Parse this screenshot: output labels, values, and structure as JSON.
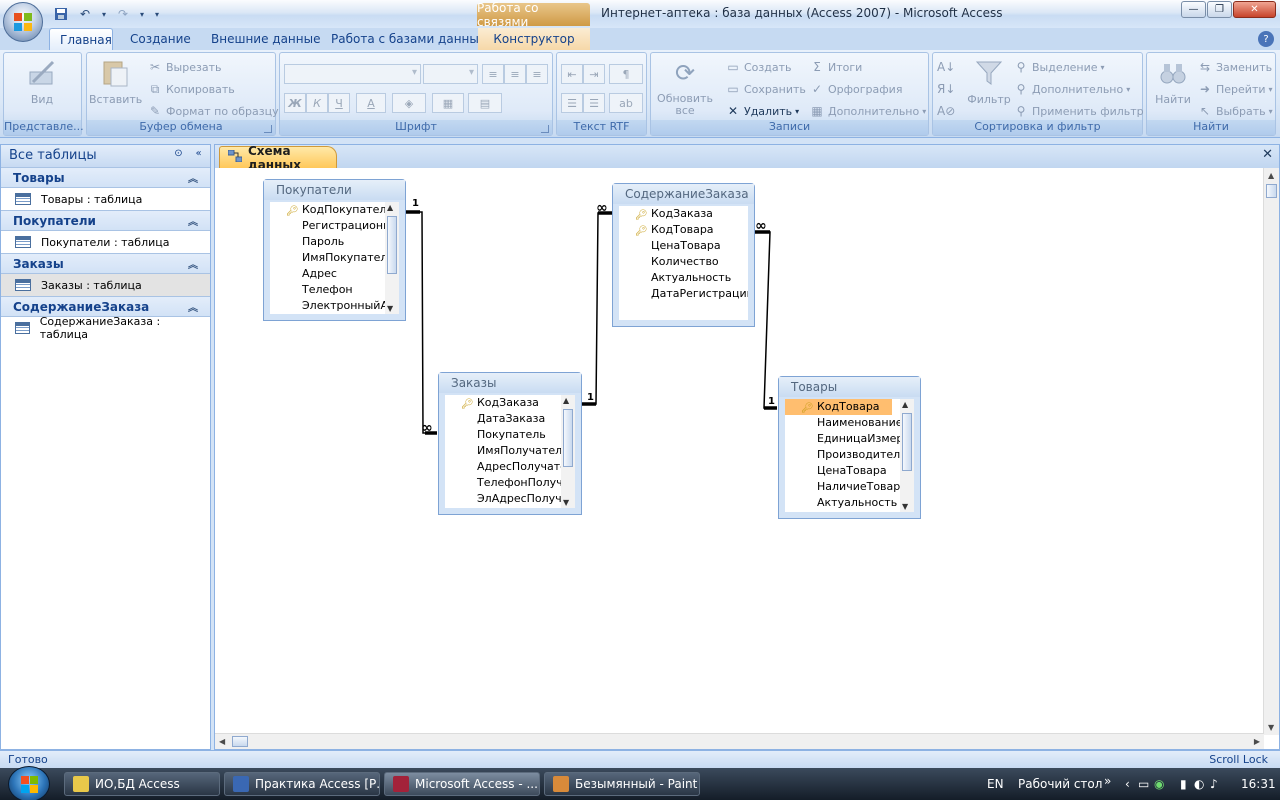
{
  "titlebar": {
    "context_tab": "Работа со связями",
    "title": "Интернет-аптека : база данных (Access 2007) - Microsoft Access"
  },
  "ribbon_tabs": [
    "Главная",
    "Создание",
    "Внешние данные",
    "Работа с базами данных",
    "Конструктор"
  ],
  "ribbon": {
    "views": {
      "label": "Представле...",
      "btn": "Вид"
    },
    "clipboard": {
      "label": "Буфер обмена",
      "paste": "Вставить",
      "cut": "Вырезать",
      "copy": "Копировать",
      "format_painter": "Формат по образцу"
    },
    "font": {
      "label": "Шрифт",
      "bold": "Ж",
      "italic": "К",
      "underline": "Ч",
      "color": "А"
    },
    "rtf": {
      "label": "Текст RTF"
    },
    "records": {
      "label": "Записи",
      "refresh": "Обновить все",
      "new": "Создать",
      "save": "Сохранить",
      "delete": "Удалить",
      "totals": "Итоги",
      "spelling": "Орфография",
      "more": "Дополнительно"
    },
    "sort": {
      "label": "Сортировка и фильтр",
      "filter": "Фильтр",
      "selection": "Выделение",
      "advanced": "Дополнительно",
      "toggle": "Применить фильтр"
    },
    "find": {
      "label": "Найти",
      "find": "Найти",
      "replace": "Заменить",
      "goto": "Перейти",
      "select": "Выбрать"
    }
  },
  "nav": {
    "header": "Все таблицы",
    "groups": [
      {
        "title": "Товары",
        "item": "Товары : таблица"
      },
      {
        "title": "Покупатели",
        "item": "Покупатели : таблица"
      },
      {
        "title": "Заказы",
        "item": "Заказы : таблица"
      },
      {
        "title": "СодержаниеЗаказа",
        "item": "СодержаниеЗаказа : таблица"
      }
    ]
  },
  "doc_tab": "Схема данных",
  "tables": {
    "customers": {
      "title": "Покупатели",
      "fields": [
        "КодПокупателя",
        "РегистрационныйНомер",
        "Пароль",
        "ИмяПокупателя",
        "Адрес",
        "Телефон",
        "ЭлектронныйАдрес"
      ]
    },
    "order_items": {
      "title": "СодержаниеЗаказа",
      "fields": [
        "КодЗаказа",
        "КодТовара",
        "ЦенаТовара",
        "Количество",
        "Актуальность",
        "ДатаРегистрации"
      ]
    },
    "orders": {
      "title": "Заказы",
      "fields": [
        "КодЗаказа",
        "ДатаЗаказа",
        "Покупатель",
        "ИмяПолучателя",
        "АдресПолучателя",
        "ТелефонПолучателя",
        "ЭлАдресПолучателя"
      ]
    },
    "products": {
      "title": "Товары",
      "fields": [
        "КодТовара",
        "Наименование",
        "ЕдиницаИзмерения",
        "Производитель",
        "ЦенаТовара",
        "НаличиеТовара",
        "Актуальность"
      ]
    }
  },
  "relations": {
    "one": "1",
    "many": "∞"
  },
  "status": {
    "left": "Готово",
    "right": "Scroll Lock"
  },
  "taskbar": {
    "tasks": [
      "ИО,БД Access",
      "Практика Access [Р...",
      "Microsoft Access - ...",
      "Безымянный - Paint"
    ],
    "lang": "EN",
    "desktop": "Рабочий стол",
    "time": "16:31"
  },
  "colors": {
    "accent": "#15428b",
    "highlight": "#ffbe6f",
    "context": "#cf9a45"
  }
}
